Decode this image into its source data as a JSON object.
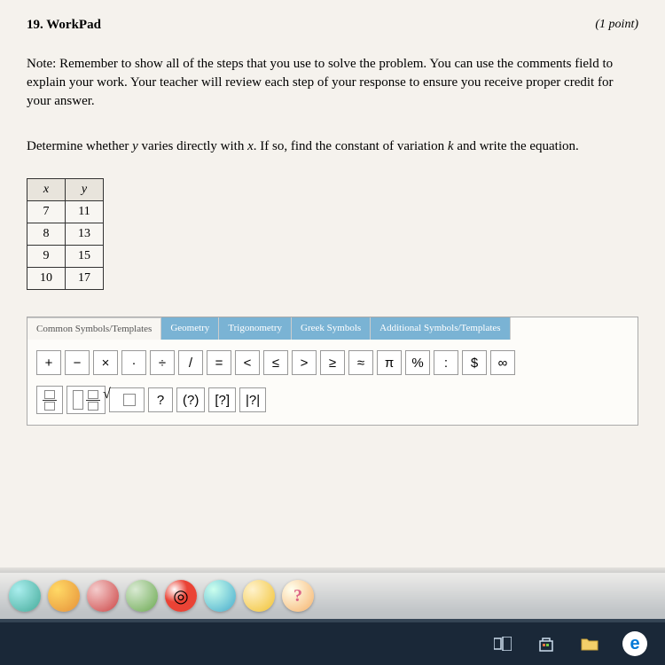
{
  "header": {
    "number": "19.",
    "title": "WorkPad",
    "points": "(1 point)"
  },
  "note": "Note: Remember to show all of the steps that you use to solve the problem. You can use the comments field to explain your work. Your teacher will review each step of your response to ensure you receive proper credit for your answer.",
  "prompt_pre": "Determine whether ",
  "prompt_y": "y",
  "prompt_mid": " varies directly with ",
  "prompt_x": "x",
  "prompt_mid2": ". If so, find the constant of variation ",
  "prompt_k": "k",
  "prompt_end": " and write the equation.",
  "table": {
    "hx": "x",
    "hy": "y",
    "rows": [
      [
        "7",
        "11"
      ],
      [
        "8",
        "13"
      ],
      [
        "9",
        "15"
      ],
      [
        "10",
        "17"
      ]
    ]
  },
  "tabs": {
    "t1": "Common Symbols/Templates",
    "t2": "Geometry",
    "t3": "Trigonometry",
    "t4": "Greek Symbols",
    "t5": "Additional Symbols/Templates"
  },
  "sym": {
    "plus": "+",
    "minus": "−",
    "times": "×",
    "dot": "·",
    "div": "÷",
    "slash": "/",
    "eq": "=",
    "lt": "<",
    "le": "≤",
    "gt": ">",
    "ge": "≥",
    "approx": "≈",
    "pi": "π",
    "pct": "%",
    "colon": ":",
    "dollar": "$",
    "inf": "∞",
    "q": "?",
    "paren": "(?)",
    "brack": "[?]",
    "abs": "|?|"
  },
  "chart_data": {
    "type": "table",
    "columns": [
      "x",
      "y"
    ],
    "rows": [
      [
        7,
        11
      ],
      [
        8,
        13
      ],
      [
        9,
        15
      ],
      [
        10,
        17
      ]
    ]
  }
}
